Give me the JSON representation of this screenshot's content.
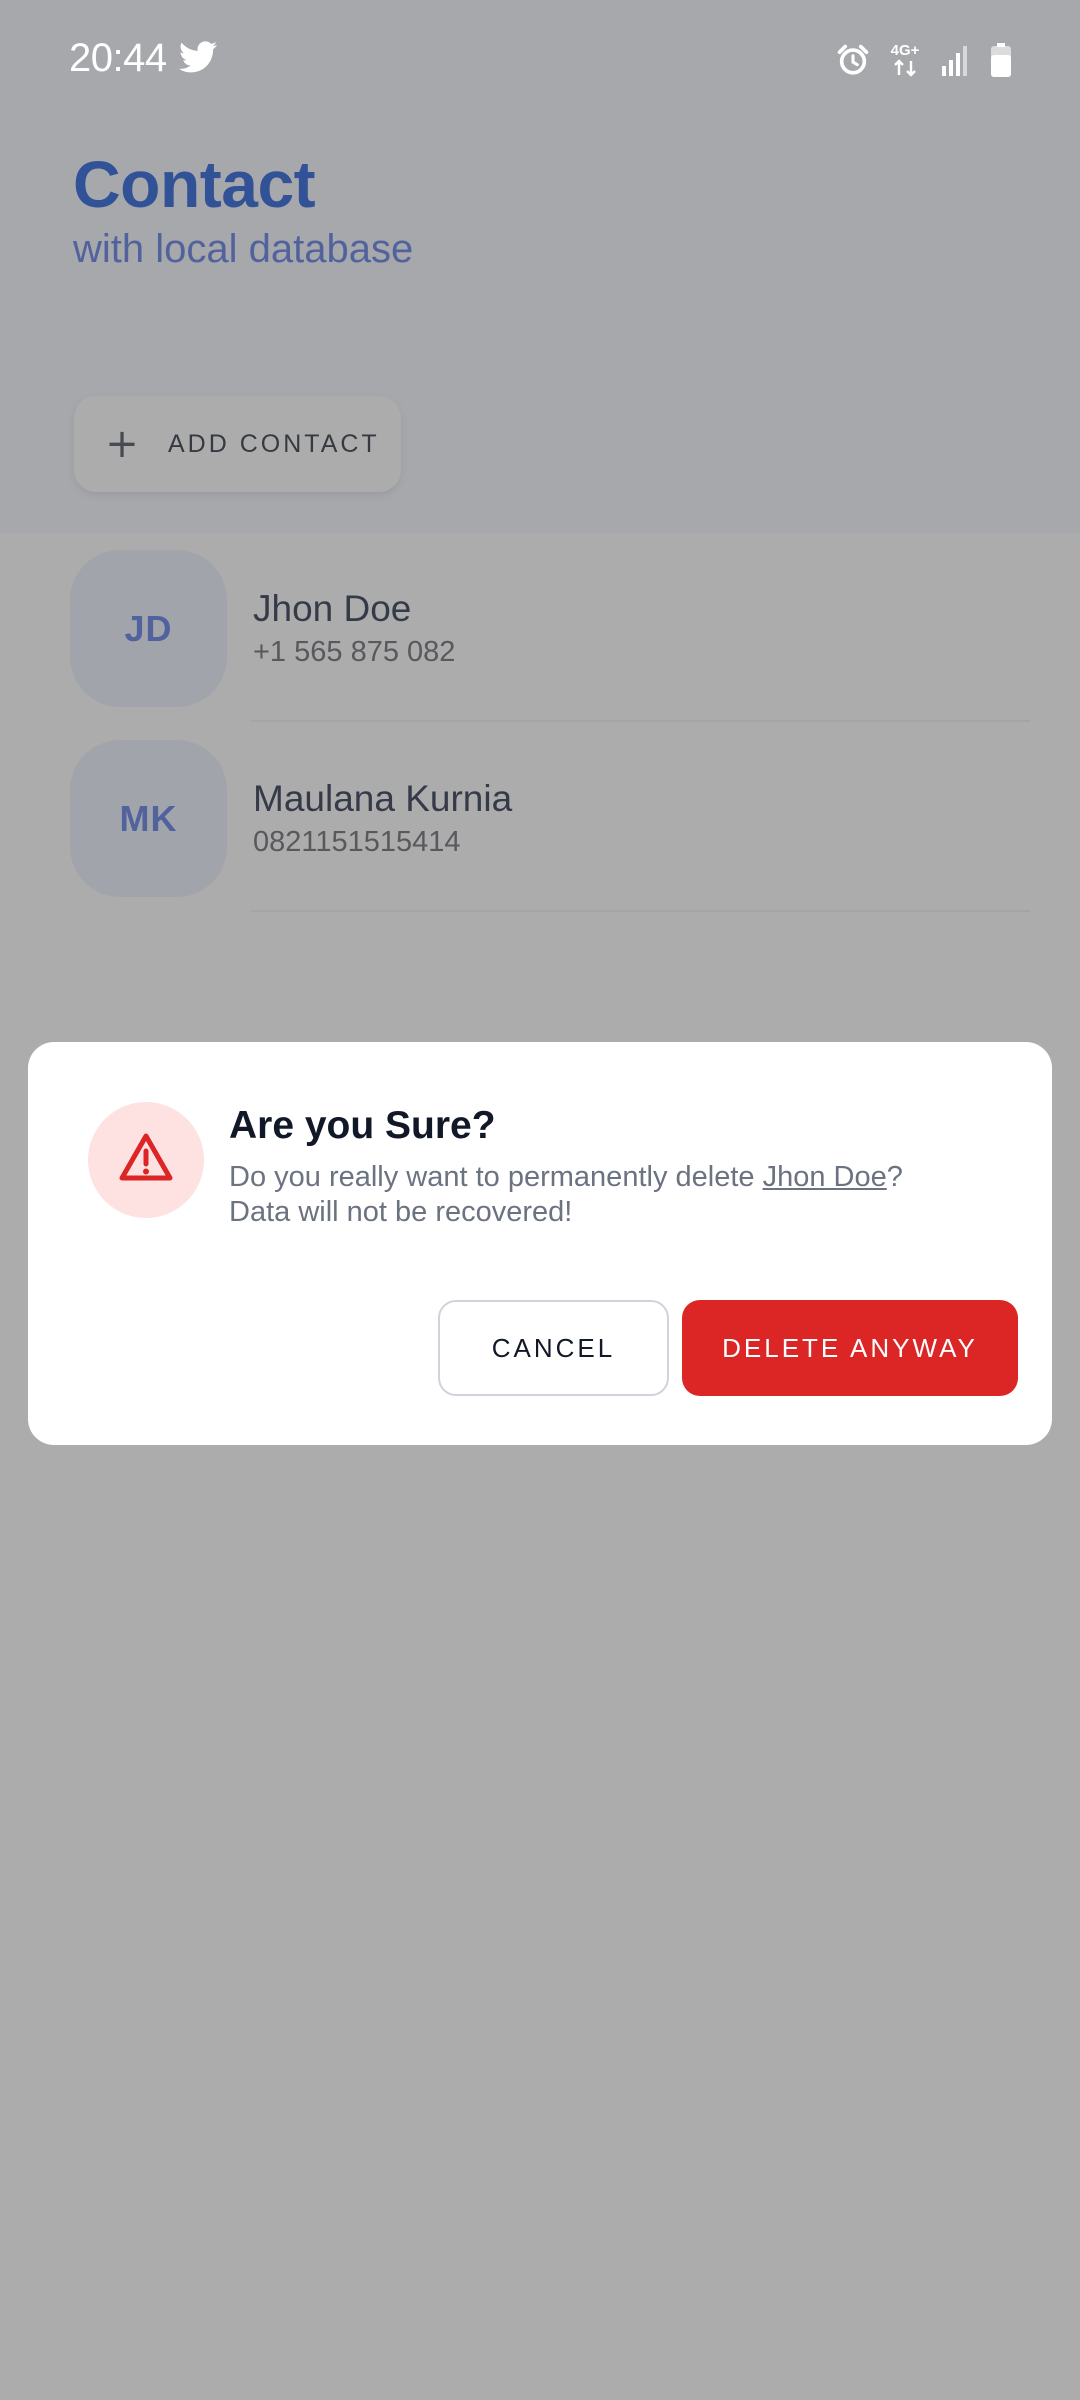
{
  "status_bar": {
    "time": "20:44",
    "network_label": "4G+",
    "icons": [
      "twitter-icon",
      "alarm-icon",
      "network-icon",
      "signal-icon",
      "battery-icon"
    ]
  },
  "header": {
    "title": "Contact",
    "subtitle": "with local database",
    "add_button_label": "ADD CONTACT"
  },
  "contacts": [
    {
      "initials": "JD",
      "name": "Jhon Doe",
      "phone": "+1 565 875 082"
    },
    {
      "initials": "MK",
      "name": "Maulana Kurnia",
      "phone": "0821151515414"
    }
  ],
  "dialog": {
    "title": "Are you Sure?",
    "message_prefix": "Do you really want to permanently delete ",
    "target_name": "Jhon Doe",
    "message_suffix": "?",
    "message_line2": "Data will not be recovered!",
    "cancel_label": "CANCEL",
    "confirm_label": "DELETE ANYWAY"
  },
  "colors": {
    "primary": "#0b4ad4",
    "accent": "#4a6be0",
    "header_background": "#f3f6fd",
    "danger": "#dc2626",
    "danger_soft": "#fee2e2",
    "overlay": "rgba(90,90,90,0.5)"
  }
}
